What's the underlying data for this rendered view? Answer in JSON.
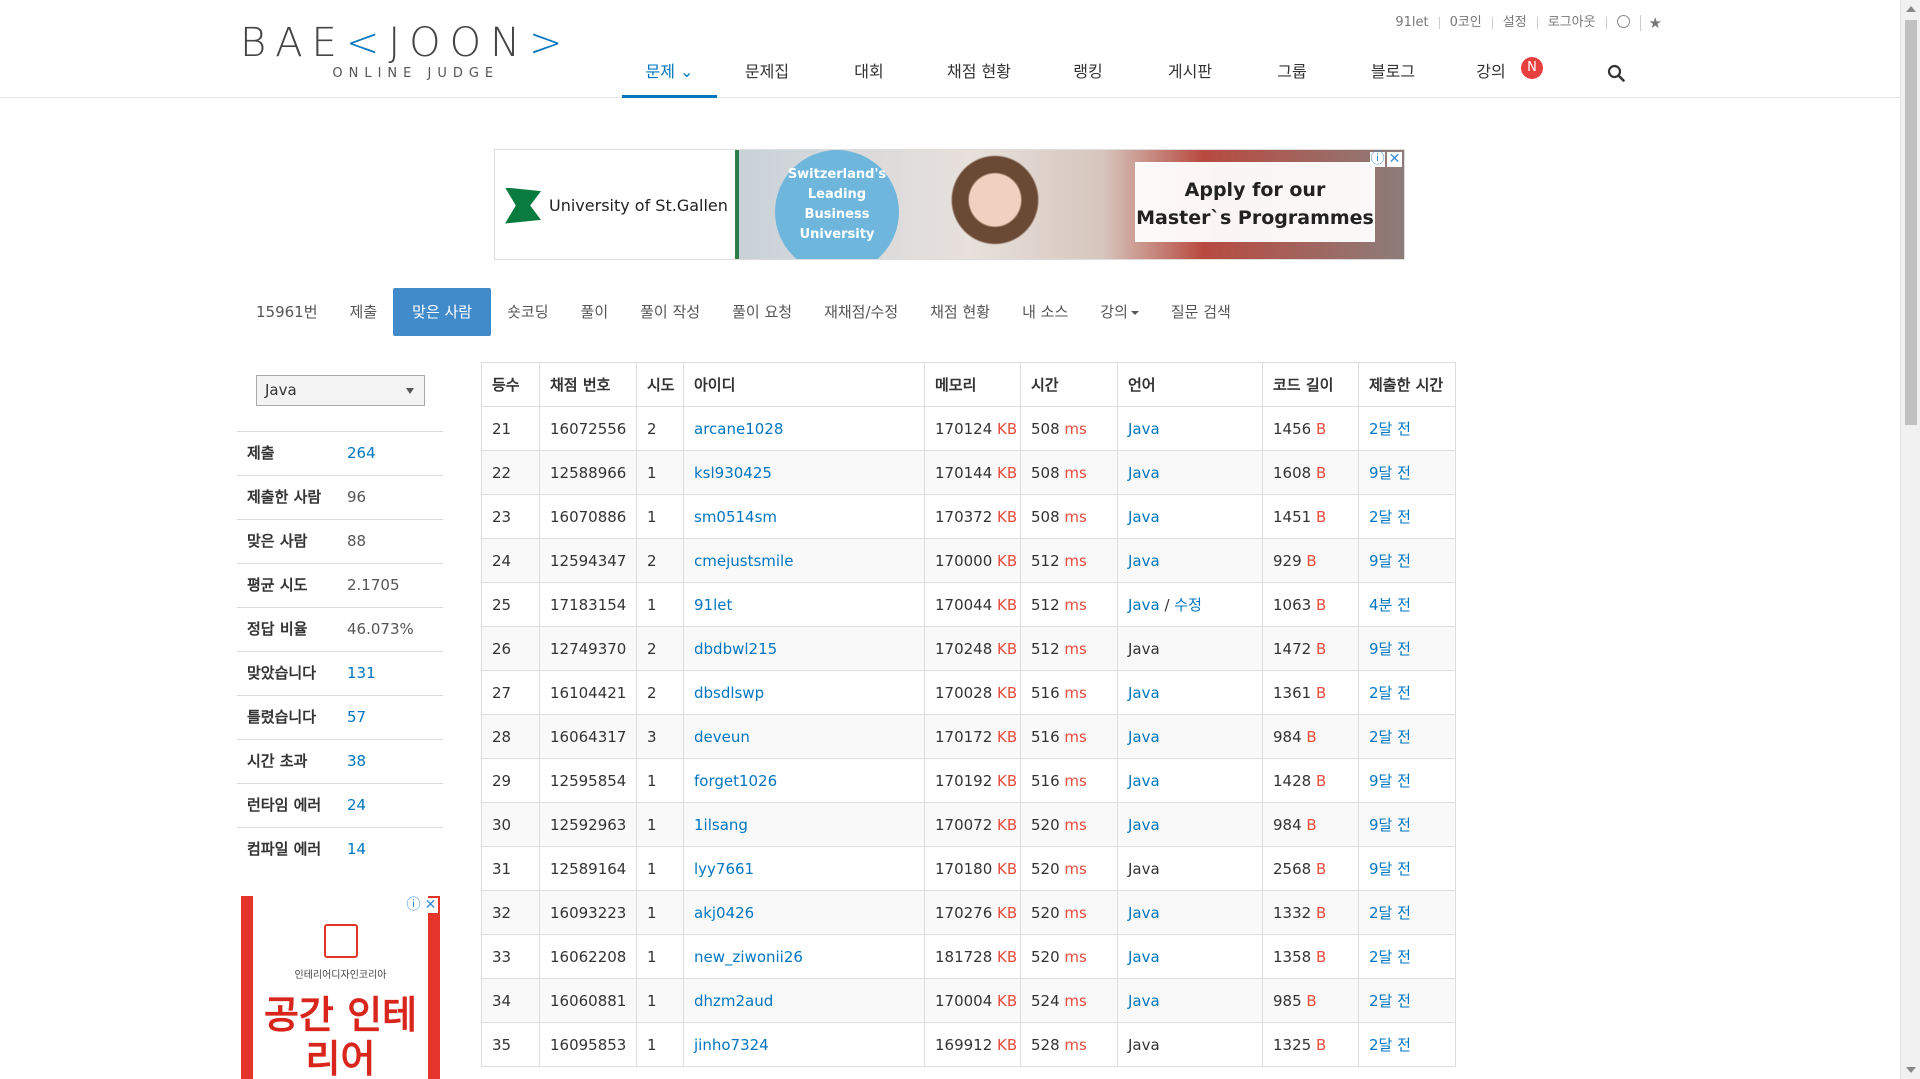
{
  "logo": {
    "main_left": "BAE",
    "main_right": "JOON",
    "sub": "ONLINE JUDGE"
  },
  "toplinks": [
    "91let",
    "0코인",
    "설정",
    "로그아웃"
  ],
  "nav": [
    {
      "label": "문제 ⌄",
      "width": 95
    },
    {
      "label": "문제집",
      "width": 100
    },
    {
      "label": "대회",
      "width": 104
    },
    {
      "label": "채점 현황",
      "width": 116
    },
    {
      "label": "랭킹",
      "width": 102
    },
    {
      "label": "게시판",
      "width": 102
    },
    {
      "label": "그룹",
      "width": 102
    },
    {
      "label": "블로그",
      "width": 100
    },
    {
      "label": "강의",
      "width": 96
    }
  ],
  "nav_badge": "N",
  "ad_top": {
    "university": "University of St.Gallen",
    "circle_text": "Switzerland's Leading Business University",
    "cta": "Apply for our Master`s Programmes"
  },
  "subtabs": [
    "15961번",
    "제출",
    "맞은 사람",
    "숏코딩",
    "풀이",
    "풀이 작성",
    "풀이 요청",
    "재채점/수정",
    "채점 현황",
    "내 소스",
    "강의",
    "질문 검색"
  ],
  "language_filter": "Java",
  "stats": [
    {
      "label": "제출",
      "value": "264",
      "link": true
    },
    {
      "label": "제출한 사람",
      "value": "96",
      "link": false
    },
    {
      "label": "맞은 사람",
      "value": "88",
      "link": false
    },
    {
      "label": "평균 시도",
      "value": "2.1705",
      "link": false
    },
    {
      "label": "정답 비율",
      "value": "46.073%",
      "link": false
    },
    {
      "label": "맞았습니다",
      "value": "131",
      "link": true
    },
    {
      "label": "틀렸습니다",
      "value": "57",
      "link": true
    },
    {
      "label": "시간 초과",
      "value": "38",
      "link": true
    },
    {
      "label": "런타임 에러",
      "value": "24",
      "link": true
    },
    {
      "label": "컴파일 에러",
      "value": "14",
      "link": true
    }
  ],
  "ad_side": {
    "brand": "인테리어디자인코리아",
    "headline": "공간 인테리어"
  },
  "table": {
    "headers": [
      "등수",
      "채점 번호",
      "시도",
      "아이디",
      "메모리",
      "시간",
      "언어",
      "코드 길이",
      "제출한 시간"
    ],
    "units": {
      "memory": "KB",
      "time": "ms",
      "code": "B"
    },
    "edit_label": "수정",
    "rows": [
      {
        "rank": "21",
        "sid": "16072556",
        "try": "2",
        "user": "arcane1028",
        "mem": "170124",
        "time": "508",
        "lang": "Java",
        "lang_link": true,
        "edit": false,
        "len": "1456",
        "when": "2달 전"
      },
      {
        "rank": "22",
        "sid": "12588966",
        "try": "1",
        "user": "ksl930425",
        "mem": "170144",
        "time": "508",
        "lang": "Java",
        "lang_link": true,
        "edit": false,
        "len": "1608",
        "when": "9달 전"
      },
      {
        "rank": "23",
        "sid": "16070886",
        "try": "1",
        "user": "sm0514sm",
        "mem": "170372",
        "time": "508",
        "lang": "Java",
        "lang_link": true,
        "edit": false,
        "len": "1451",
        "when": "2달 전"
      },
      {
        "rank": "24",
        "sid": "12594347",
        "try": "2",
        "user": "cmejustsmile",
        "mem": "170000",
        "time": "512",
        "lang": "Java",
        "lang_link": true,
        "edit": false,
        "len": "929",
        "when": "9달 전"
      },
      {
        "rank": "25",
        "sid": "17183154",
        "try": "1",
        "user": "91let",
        "mem": "170044",
        "time": "512",
        "lang": "Java",
        "lang_link": true,
        "edit": true,
        "len": "1063",
        "when": "4분 전"
      },
      {
        "rank": "26",
        "sid": "12749370",
        "try": "2",
        "user": "dbdbwl215",
        "mem": "170248",
        "time": "512",
        "lang": "Java",
        "lang_link": false,
        "edit": false,
        "len": "1472",
        "when": "9달 전"
      },
      {
        "rank": "27",
        "sid": "16104421",
        "try": "2",
        "user": "dbsdlswp",
        "mem": "170028",
        "time": "516",
        "lang": "Java",
        "lang_link": true,
        "edit": false,
        "len": "1361",
        "when": "2달 전"
      },
      {
        "rank": "28",
        "sid": "16064317",
        "try": "3",
        "user": "deveun",
        "mem": "170172",
        "time": "516",
        "lang": "Java",
        "lang_link": true,
        "edit": false,
        "len": "984",
        "when": "2달 전"
      },
      {
        "rank": "29",
        "sid": "12595854",
        "try": "1",
        "user": "forget1026",
        "mem": "170192",
        "time": "516",
        "lang": "Java",
        "lang_link": true,
        "edit": false,
        "len": "1428",
        "when": "9달 전"
      },
      {
        "rank": "30",
        "sid": "12592963",
        "try": "1",
        "user": "1ilsang",
        "mem": "170072",
        "time": "520",
        "lang": "Java",
        "lang_link": true,
        "edit": false,
        "len": "984",
        "when": "9달 전"
      },
      {
        "rank": "31",
        "sid": "12589164",
        "try": "1",
        "user": "lyy7661",
        "mem": "170180",
        "time": "520",
        "lang": "Java",
        "lang_link": false,
        "edit": false,
        "len": "2568",
        "when": "9달 전"
      },
      {
        "rank": "32",
        "sid": "16093223",
        "try": "1",
        "user": "akj0426",
        "mem": "170276",
        "time": "520",
        "lang": "Java",
        "lang_link": true,
        "edit": false,
        "len": "1332",
        "when": "2달 전"
      },
      {
        "rank": "33",
        "sid": "16062208",
        "try": "1",
        "user": "new_ziwonii26",
        "mem": "181728",
        "time": "520",
        "lang": "Java",
        "lang_link": true,
        "edit": false,
        "len": "1358",
        "when": "2달 전"
      },
      {
        "rank": "34",
        "sid": "16060881",
        "try": "1",
        "user": "dhzm2aud",
        "mem": "170004",
        "time": "524",
        "lang": "Java",
        "lang_link": true,
        "edit": false,
        "len": "985",
        "when": "2달 전"
      },
      {
        "rank": "35",
        "sid": "16095853",
        "try": "1",
        "user": "jinho7324",
        "mem": "169912",
        "time": "528",
        "lang": "Java",
        "lang_link": false,
        "edit": false,
        "len": "1325",
        "when": "2달 전"
      }
    ]
  }
}
